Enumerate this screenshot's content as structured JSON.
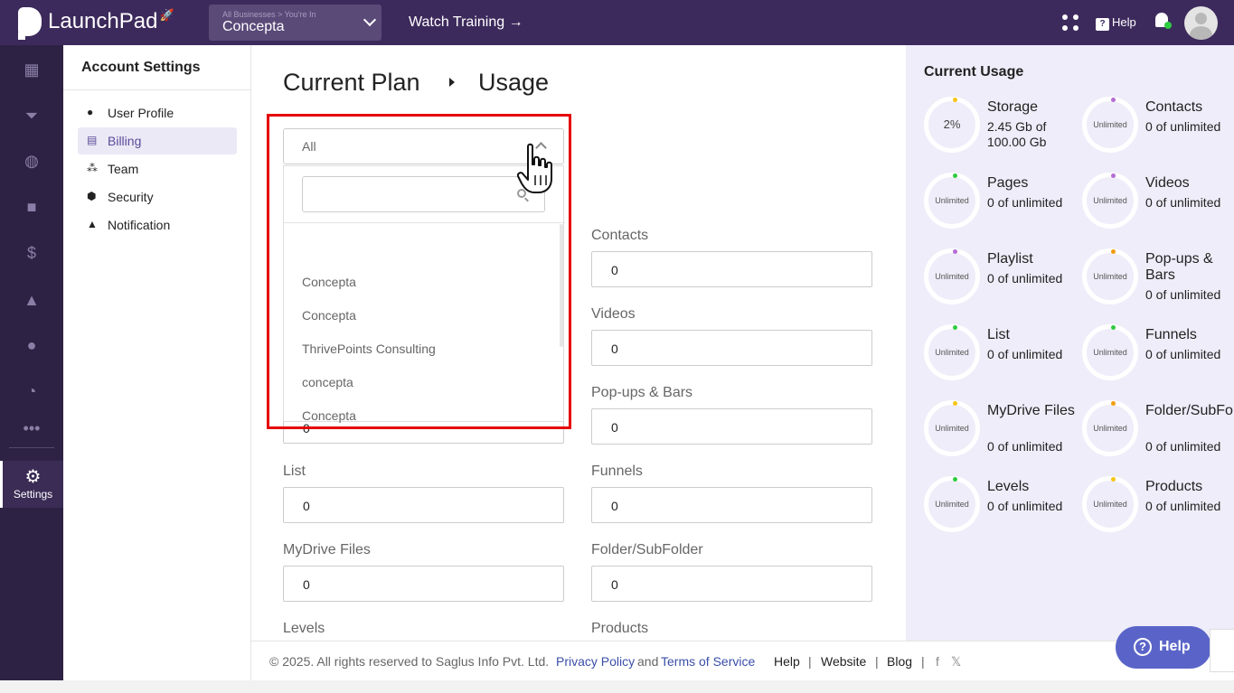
{
  "topbar": {
    "app_name": "LaunchPad",
    "business_breadcrumb": "All Businesses > You're In",
    "business_name": "Concepta",
    "watch_training": "Watch Training →",
    "help_label": "Help"
  },
  "leftnav": {
    "settings_label": "Settings",
    "icons": [
      "dashboard-icon",
      "funnel-icon",
      "globe-icon",
      "video-icon",
      "dollar-icon",
      "analytics-icon",
      "team-icon",
      "report-icon",
      "more-icon"
    ]
  },
  "sidebar": {
    "title": "Account Settings",
    "items": [
      {
        "label": "User Profile",
        "icon": "user-icon",
        "active": false
      },
      {
        "label": "Billing",
        "icon": "billing-icon",
        "active": true
      },
      {
        "label": "Team",
        "icon": "team-icon",
        "active": false
      },
      {
        "label": "Security",
        "icon": "shield-icon",
        "active": false
      },
      {
        "label": "Notification",
        "icon": "bell-icon",
        "active": false
      }
    ]
  },
  "main": {
    "breadcrumb_1": "Current Plan",
    "breadcrumb_2": "Usage",
    "dropdown": {
      "selected": "All",
      "search_placeholder": "",
      "options": [
        "Concepta",
        "Concepta",
        "ThrivePoints Consulting",
        "concepta",
        "Concepta"
      ]
    },
    "hidden_field_value": "0",
    "fields": [
      {
        "label": "Contacts",
        "value": "0"
      },
      {
        "label": "Videos",
        "value": "0"
      },
      {
        "label": "Pop-ups & Bars",
        "value": "0"
      },
      {
        "label": "List",
        "value": "0"
      },
      {
        "label": "Funnels",
        "value": "0"
      },
      {
        "label": "MyDrive Files",
        "value": "0"
      },
      {
        "label": "Folder/SubFolder",
        "value": "0"
      },
      {
        "label": "Levels",
        "value": ""
      },
      {
        "label": "Products",
        "value": ""
      }
    ]
  },
  "usage": {
    "title": "Current Usage",
    "items": [
      {
        "name": "Storage",
        "value": "2.45 Gb of 100.00 Gb",
        "ring": "2%",
        "dot": "#f5c518"
      },
      {
        "name": "Contacts",
        "value": "0 of unlimited",
        "ring": "Unlimited",
        "dot": "#b66bd6"
      },
      {
        "name": "Pages",
        "value": "0 of unlimited",
        "ring": "Unlimited",
        "dot": "#2ecc40"
      },
      {
        "name": "Videos",
        "value": "0 of unlimited",
        "ring": "Unlimited",
        "dot": "#b66bd6"
      },
      {
        "name": "Playlist",
        "value": "0 of unlimited",
        "ring": "Unlimited",
        "dot": "#b66bd6"
      },
      {
        "name": "Pop-ups & Bars",
        "value": "0 of unlimited",
        "ring": "Unlimited",
        "dot": "#f39c12"
      },
      {
        "name": "List",
        "value": "0 of unlimited",
        "ring": "Unlimited",
        "dot": "#2ecc40"
      },
      {
        "name": "Funnels",
        "value": "0 of unlimited",
        "ring": "Unlimited",
        "dot": "#2ecc40"
      },
      {
        "name": "MyDrive Files",
        "value": "0 of unlimited",
        "ring": "Unlimited",
        "dot": "#f5c518"
      },
      {
        "name": "Folder/SubFolder",
        "value": "0 of unlimited",
        "ring": "Unlimited",
        "dot": "#f39c12"
      },
      {
        "name": "Levels",
        "value": "0 of unlimited",
        "ring": "Unlimited",
        "dot": "#2ecc40"
      },
      {
        "name": "Products",
        "value": "0 of unlimited",
        "ring": "Unlimited",
        "dot": "#f5c518"
      }
    ]
  },
  "footer": {
    "copyright": "©  2025. All rights reserved to Saglus Info Pvt. Ltd.",
    "privacy": "Privacy Policy",
    "and": "and",
    "terms": "Terms of Service",
    "help": "Help",
    "website": "Website",
    "blog": "Blog",
    "sep": "|"
  },
  "help_fab": "Help",
  "colors": {
    "topbar": "#3d2a5c",
    "leftnav": "#2e2244",
    "accent": "#5a64c8",
    "highlight": "#e60000"
  }
}
